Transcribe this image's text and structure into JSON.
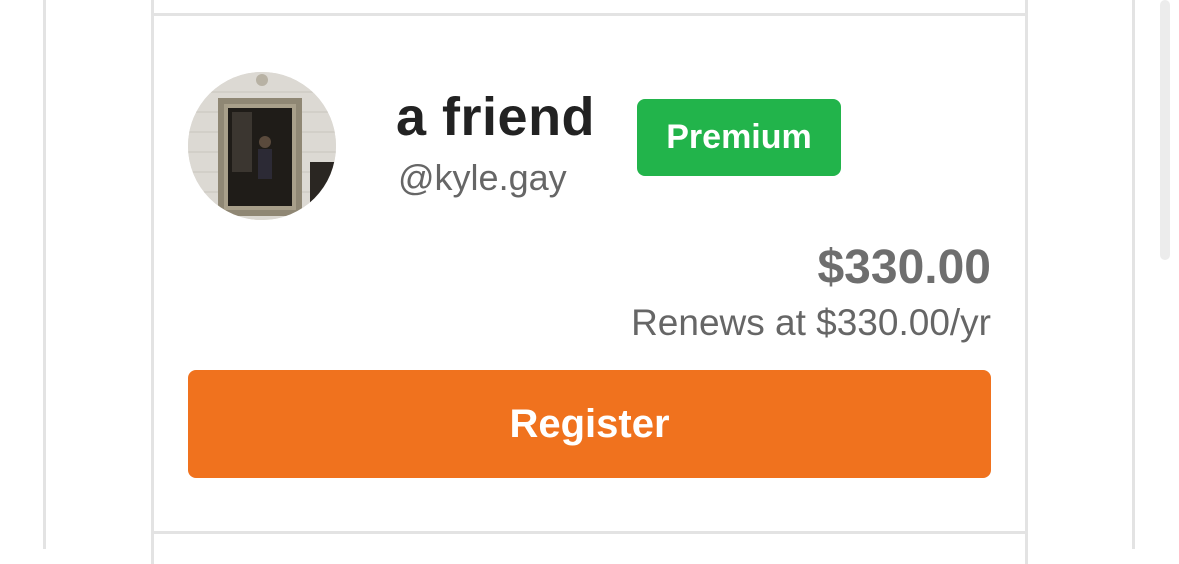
{
  "listing": {
    "display_name": "a friend",
    "handle": "@kyle.gay",
    "badge": "Premium",
    "price": "$330.00",
    "renewal": "Renews at $330.00/yr",
    "register_label": "Register"
  },
  "colors": {
    "badge_bg": "#22b44b",
    "register_bg": "#f0721e",
    "border": "#e3e3e3"
  }
}
